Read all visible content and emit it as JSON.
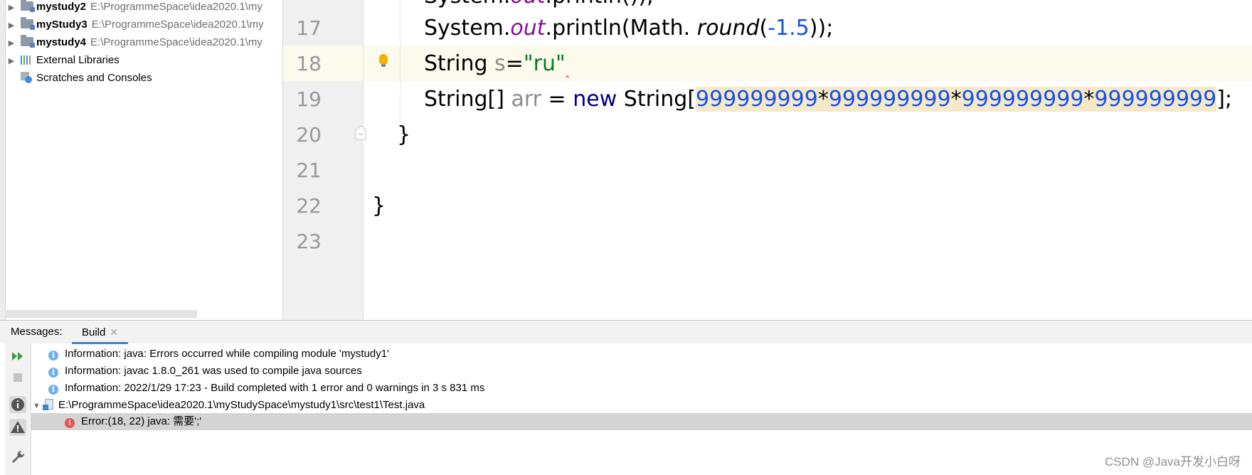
{
  "project_tree": {
    "modules": [
      {
        "name": "mystudy2",
        "path": "E:\\ProgrammeSpace\\idea2020.1\\my"
      },
      {
        "name": "myStudy3",
        "path": "E:\\ProgrammeSpace\\idea2020.1\\my"
      },
      {
        "name": "mystudy4",
        "path": "E:\\ProgrammeSpace\\idea2020.1\\my"
      }
    ],
    "external_libraries": "External Libraries",
    "scratches": "Scratches and Consoles"
  },
  "editor": {
    "line_numbers": [
      "17",
      "18",
      "19",
      "20",
      "21",
      "22",
      "23"
    ],
    "line17": {
      "a": "System.",
      "out": "out",
      "b": ".println(Math. ",
      "round": "round",
      "c": "(",
      "num": "-1.5",
      "d": "));"
    },
    "line18": {
      "kw": "String ",
      "var": "s",
      "eq": "=",
      "str": "\"ru\"",
      "squiggle": "‸"
    },
    "line19": {
      "a": "String[] ",
      "var": "arr",
      "b": " = ",
      "kw": "new",
      "c": " String[",
      "n1": "999999999",
      "op1": "*",
      "n2": "999999999",
      "op2": "*",
      "n3": "999999999",
      "op3": "*",
      "n4": "999999999",
      "d": "];"
    },
    "line20": "}",
    "line22": "}"
  },
  "messages": {
    "title": "Messages:",
    "tab": "Build",
    "rows": [
      "Information: java: Errors occurred while compiling module 'mystudy1'",
      "Information: javac 1.8.0_261 was used to compile java sources",
      "Information: 2022/1/29 17:23 - Build completed with 1 error and 0 warnings in 3 s 831 ms"
    ],
    "file_path": "E:\\ProgrammeSpace\\idea2020.1\\myStudySpace\\mystudy1\\src\\test1\\Test.java",
    "error": "Error:(18, 22)  java: 需要';'"
  },
  "watermark": "CSDN @Java开发小白呀",
  "icons": {
    "rerun": "rerun-icon",
    "stop": "stop-icon",
    "info_filter": "info-filter-icon",
    "warning_filter": "warning-filter-icon",
    "settings": "wrench-icon",
    "bulb": "lightbulb-icon"
  }
}
